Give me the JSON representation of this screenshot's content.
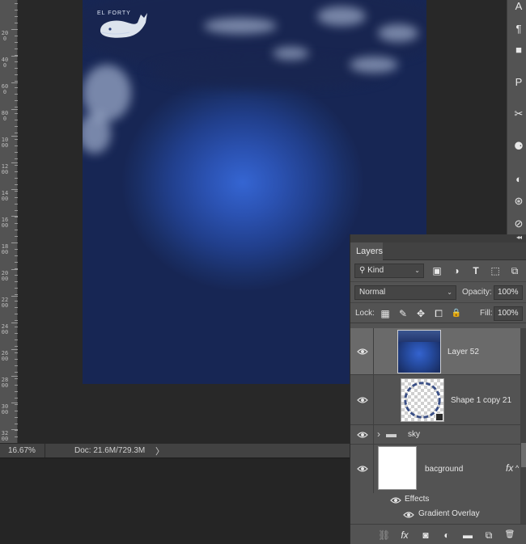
{
  "status_bar": {
    "zoom": "16.67%",
    "doc_info": "Doc: 21.6M/729.3M",
    "arrow": "〉"
  },
  "ruler": {
    "labels": [
      "200",
      "400",
      "600",
      "800",
      "1000",
      "1200",
      "1400",
      "1600",
      "1800",
      "2000",
      "2200",
      "2400",
      "2600",
      "2800",
      "3000",
      "3200"
    ]
  },
  "watermark_text": "EL FORTY",
  "tool_strip": {
    "tools": [
      {
        "icon": "type-tool-icon",
        "glyph": "A"
      },
      {
        "icon": "path-selection-icon",
        "glyph": "¶"
      },
      {
        "icon": "swatches-icon",
        "glyph": "■"
      },
      {
        "icon": "paragraph-icon",
        "glyph": "P"
      },
      {
        "icon": "tools-icon",
        "glyph": "✂"
      },
      {
        "icon": "brush-presets-icon",
        "glyph": "⚈"
      },
      {
        "icon": "styles-icon",
        "glyph": "◐"
      },
      {
        "icon": "adjustments-icon",
        "glyph": "⊛"
      },
      {
        "icon": "navigator-icon",
        "glyph": "⊘"
      }
    ]
  },
  "layers_panel": {
    "collapse_glyph": "◂◂",
    "tab_label": "Layers",
    "filter": {
      "label": "Kind",
      "search_glyph": "⚲",
      "arrow": "⌄"
    },
    "filter_icons": [
      {
        "name": "pixel-filter-icon",
        "glyph": "▣"
      },
      {
        "name": "adjustment-filter-icon",
        "glyph": "◑"
      },
      {
        "name": "type-filter-icon",
        "glyph": "T"
      },
      {
        "name": "shape-filter-icon",
        "glyph": "⬚"
      },
      {
        "name": "smart-object-filter-icon",
        "glyph": "⧉"
      }
    ],
    "blend_mode": {
      "value": "Normal",
      "arrow": "⌄"
    },
    "opacity": {
      "label": "Opacity:",
      "value": "100%"
    },
    "lock": {
      "label": "Lock:"
    },
    "lock_icons": [
      {
        "name": "lock-transparent-pixels-icon",
        "glyph": "▦"
      },
      {
        "name": "lock-image-pixels-icon",
        "glyph": "✎"
      },
      {
        "name": "lock-position-icon",
        "glyph": "✥"
      },
      {
        "name": "lock-artboard-icon",
        "glyph": "⧠"
      },
      {
        "name": "lock-all-icon",
        "glyph": "🔒"
      }
    ],
    "fill": {
      "label": "Fill:",
      "value": "100%"
    },
    "layers": [
      {
        "name": "Layer 52",
        "selected": true
      },
      {
        "name": "Shape 1 copy 21",
        "selected": false
      },
      {
        "name": "sky",
        "selected": false,
        "folder_glyph": "▬",
        "expand_glyph": "›"
      },
      {
        "name": "bacground",
        "selected": false,
        "fx": "fx",
        "fx_arrow": "^"
      }
    ],
    "effects_label": "Effects",
    "gradient_overlay_label": "Gradient Overlay",
    "footer_icons": [
      {
        "name": "link-layers-icon",
        "glyph": "⛓"
      },
      {
        "name": "add-layer-style-icon",
        "glyph": "fx"
      },
      {
        "name": "add-mask-icon",
        "glyph": "◙"
      },
      {
        "name": "new-adjustment-layer-icon",
        "glyph": "◐"
      },
      {
        "name": "new-group-icon",
        "glyph": "▬"
      },
      {
        "name": "new-layer-icon",
        "glyph": "⧉"
      },
      {
        "name": "delete-layer-icon",
        "glyph": "🗑"
      }
    ]
  },
  "colors": {
    "panel": "#535353",
    "selected_row": "#6a6a6a",
    "canvas_bg": "#282828",
    "sky_center": "#3565d2",
    "sky_edge": "#172654"
  }
}
